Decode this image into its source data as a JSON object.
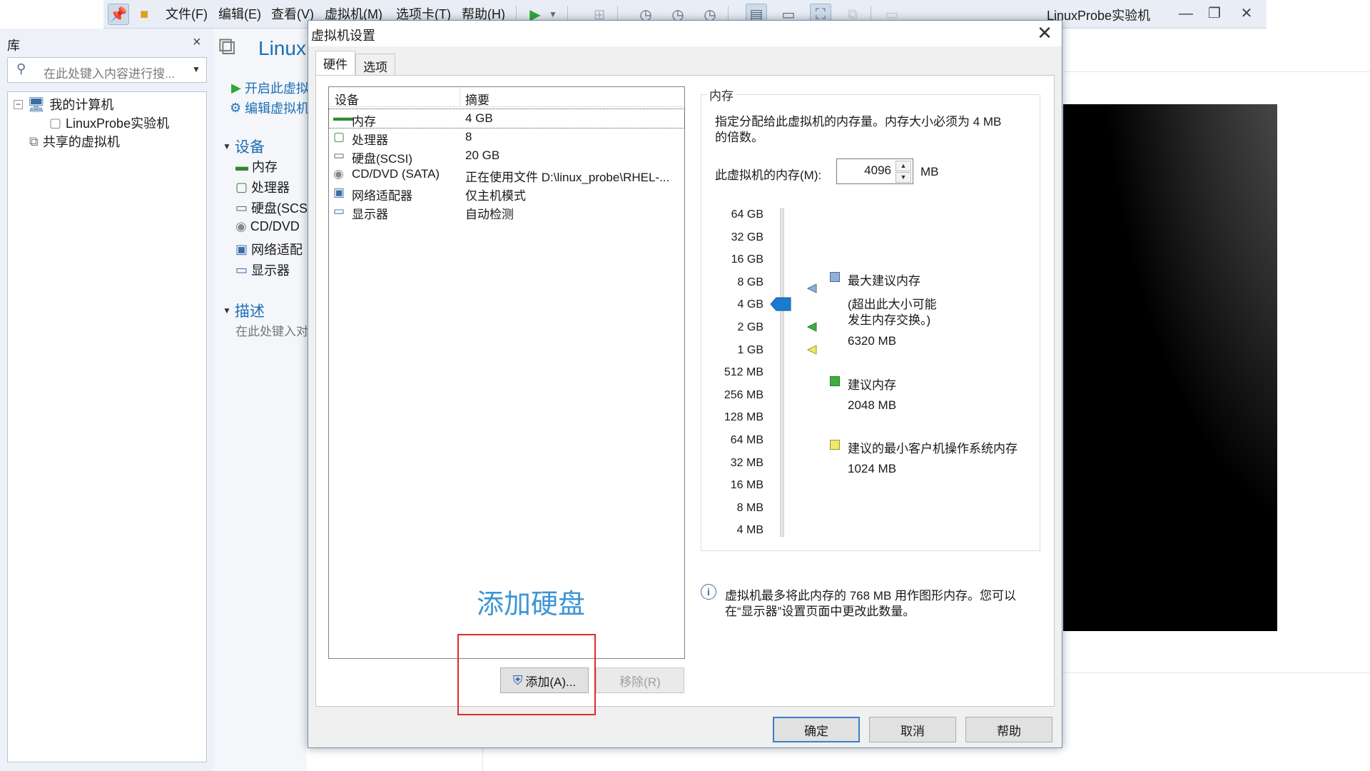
{
  "menubar": {
    "items": [
      "文件(F)",
      "编辑(E)",
      "查看(V)",
      "虚拟机(M)",
      "选项卡(T)",
      "帮助(H)"
    ],
    "app_title": "LinuxProbe实验机"
  },
  "library": {
    "title": "库",
    "close": "×",
    "search_placeholder": "在此处键入内容进行搜...",
    "tree": {
      "my_computer": "我的计算机",
      "vm": "LinuxProbe实验机",
      "shared": "共享的虚拟机"
    }
  },
  "middle": {
    "vm_title": "Linux",
    "power_on": "开启此虚拟",
    "edit_vm": "编辑虚拟机",
    "devices_header": "设备",
    "devices": [
      "内存",
      "处理器",
      "硬盘(SCS",
      "CD/DVD",
      "网络适配",
      "显示器"
    ],
    "description_header": "描述",
    "description_hint": "在此处键入对"
  },
  "dialog": {
    "title": "虚拟机设置",
    "close": "✕",
    "tabs": [
      "硬件",
      "选项"
    ],
    "device_list": {
      "col_device": "设备",
      "col_summary": "摘要",
      "rows": [
        {
          "name": "内存",
          "summary": "4 GB",
          "icon": "memory-icon"
        },
        {
          "name": "处理器",
          "summary": "8",
          "icon": "cpu-icon"
        },
        {
          "name": "硬盘(SCSI)",
          "summary": "20 GB",
          "icon": "harddisk-icon"
        },
        {
          "name": "CD/DVD (SATA)",
          "summary": "正在使用文件 D:\\linux_probe\\RHEL-...",
          "icon": "cdrom-icon"
        },
        {
          "name": "网络适配器",
          "summary": "仅主机模式",
          "icon": "network-icon"
        },
        {
          "name": "显示器",
          "summary": "自动检测",
          "icon": "monitor-icon"
        }
      ]
    },
    "annotation": "添加硬盘",
    "add_button": "添加(A)...",
    "remove_button": "移除(R)",
    "memory": {
      "group_title": "内存",
      "description": [
        "指定分配给此虚拟机的内存量。内存大小必须为 4 MB",
        "的倍数。"
      ],
      "field_label": "此虚拟机的内存(M):",
      "value": "4096",
      "unit": "MB",
      "scale": [
        "64 GB",
        "32 GB",
        "16 GB",
        "8 GB",
        "4 GB",
        "2 GB",
        "1 GB",
        "512 MB",
        "256 MB",
        "128 MB",
        "64 MB",
        "32 MB",
        "16 MB",
        "8 MB",
        "4 MB"
      ],
      "max_recommended_label": "最大建议内存",
      "max_recommended_note": [
        "(超出此大小可能",
        "发生内存交换。)"
      ],
      "max_recommended_value": "6320 MB",
      "recommended_label": "建议内存",
      "recommended_value": "2048 MB",
      "min_label": "建议的最小客户机操作系统内存",
      "min_value": "1024 MB",
      "info": [
        "虚拟机最多将此内存的 768 MB 用作图形内存。您可以",
        "在“显示器”设置页面中更改此数量。"
      ],
      "colors": {
        "max": "#5a7fb0",
        "recommended": "#3fae3f",
        "min": "#e8e26a",
        "slider": "#1b7bd1"
      }
    },
    "buttons": {
      "ok": "确定",
      "cancel": "取消",
      "help": "帮助"
    }
  }
}
